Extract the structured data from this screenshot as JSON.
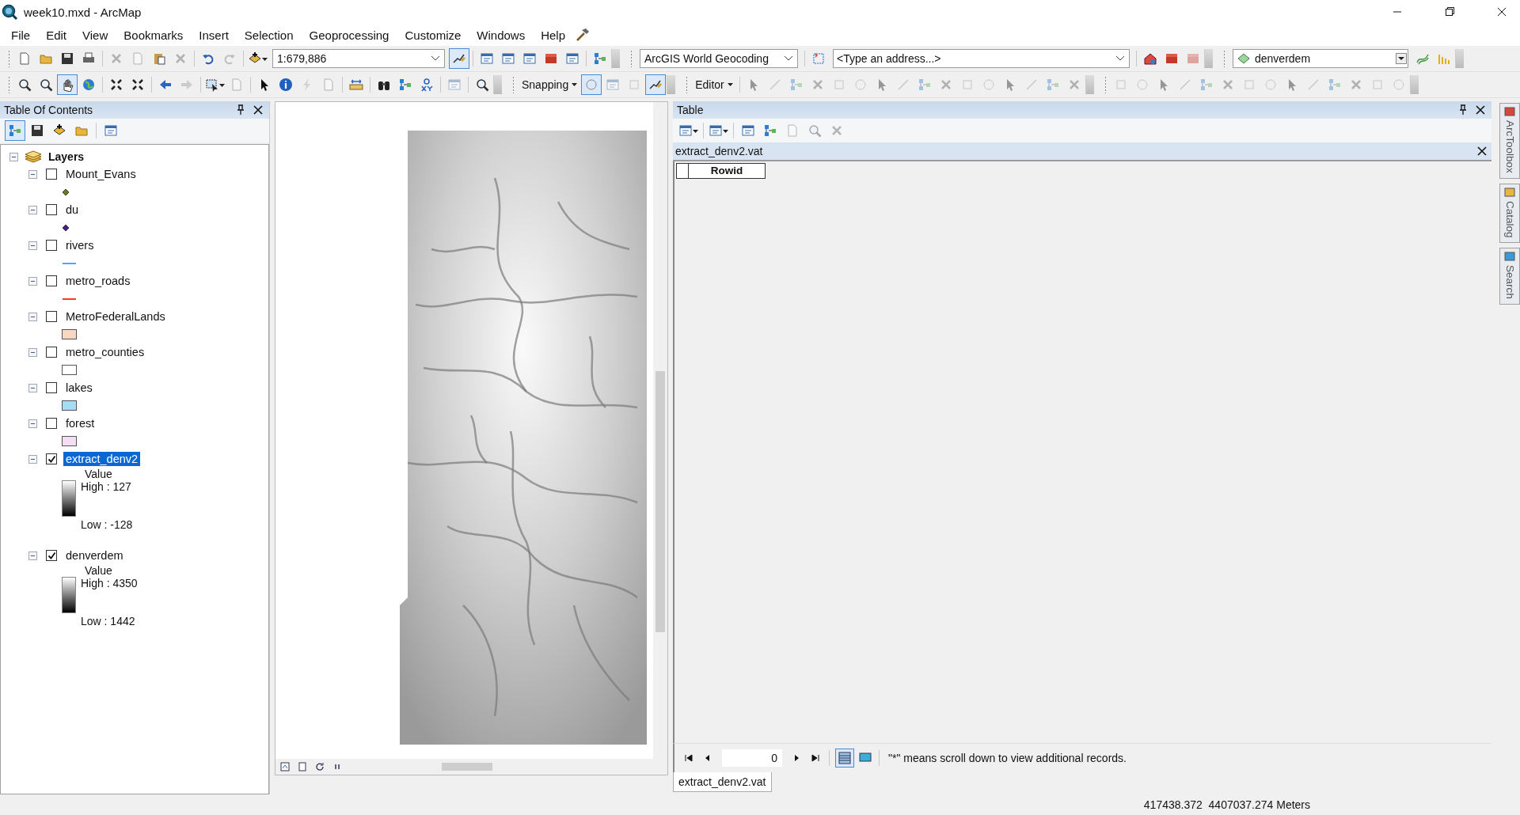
{
  "window": {
    "title": "week10.mxd - ArcMap"
  },
  "menu": [
    "File",
    "Edit",
    "View",
    "Bookmarks",
    "Insert",
    "Selection",
    "Geoprocessing",
    "Customize",
    "Windows",
    "Help"
  ],
  "toolbar": {
    "scale": "1:679,886",
    "geocoder": "ArcGIS World Geocoding",
    "address": {
      "placeholder": "<Type an address...>"
    },
    "layer": "denverdem",
    "snapping": "Snapping",
    "editor": "Editor"
  },
  "toc": {
    "title": "Table Of Contents",
    "root": {
      "label": "Layers",
      "expanded": true,
      "children": [
        {
          "name": "Mount_Evans",
          "checked": false,
          "selected": false,
          "expanded": true,
          "legend": {
            "kind": "point",
            "color": "#6b7a1e"
          }
        },
        {
          "name": "du",
          "checked": false,
          "selected": false,
          "expanded": true,
          "legend": {
            "kind": "point",
            "color": "#4b1e8c"
          }
        },
        {
          "name": "rivers",
          "checked": false,
          "selected": false,
          "expanded": true,
          "legend": {
            "kind": "line",
            "color": "#4ea6ff"
          }
        },
        {
          "name": "metro_roads",
          "checked": false,
          "selected": false,
          "expanded": true,
          "legend": {
            "kind": "line",
            "color": "#ff3b1e"
          }
        },
        {
          "name": "MetroFederalLands",
          "checked": false,
          "selected": false,
          "expanded": true,
          "legend": {
            "kind": "polygon",
            "color": "#f8d7c2"
          }
        },
        {
          "name": "metro_counties",
          "checked": false,
          "selected": false,
          "expanded": true,
          "legend": {
            "kind": "polygon",
            "color": "#ffffff"
          }
        },
        {
          "name": "lakes",
          "checked": false,
          "selected": false,
          "expanded": true,
          "legend": {
            "kind": "polygon",
            "color": "#a3dcf3"
          }
        },
        {
          "name": "forest",
          "checked": false,
          "selected": false,
          "expanded": true,
          "legend": {
            "kind": "polygon",
            "color": "#f5ddf3"
          }
        },
        {
          "name": "extract_denv2",
          "checked": true,
          "selected": true,
          "expanded": true,
          "legend": {
            "kind": "raster",
            "field": "Value",
            "high": "High : 127",
            "low": "Low : -128"
          }
        },
        {
          "name": "denverdem",
          "checked": true,
          "selected": false,
          "expanded": true,
          "legend": {
            "kind": "raster",
            "field": "Value",
            "high": "High : 4350",
            "low": "Low : 1442"
          }
        }
      ]
    }
  },
  "table": {
    "title": "Table",
    "tab": "extract_denv2.vat",
    "columns": [
      "Rowid"
    ],
    "record": "0",
    "note": "\"*\" means scroll down to view additional records.",
    "bottom_tabs": [
      {
        "label": "extract_denv2.vat",
        "selected": true
      }
    ]
  },
  "dock": [
    {
      "label": "ArcToolbox"
    },
    {
      "label": "Catalog"
    },
    {
      "label": "Search"
    }
  ],
  "status_bar": {
    "coordinates": "417438.372  4407037.274 Meters"
  }
}
